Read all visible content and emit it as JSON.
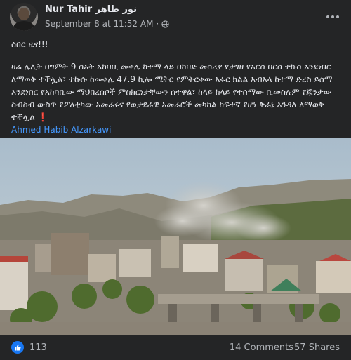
{
  "post": {
    "author": "Nur Tahir نور طاهر",
    "timestamp": "September 8 at 11:52 AM",
    "dot": "·",
    "privacy_icon": "globe-icon",
    "more_icon": "more-options-icon",
    "headline": "ሰበር ዜና!!!",
    "body": "ዛሬ ሌሊት በግምት 9 ሰአት አከባቢ መቀሌ ከተማ ላይ በከባድ መሳሪያ የታገዘ የአርስ በርስ ተኩስ እንደነበር ለማወቅ ተችሏል፣ ተኩሱ ከመቀሌ 47.9 ኪሎ ሜትር የምትርቀው አፋር ክልል አብአላ ከተማ ድረስ ይሰማ እንደነበር የአከባቢው ማህበረሰቦች ምስክርነታቸውን ሰተዋል፣ ከላይ ከላይ የተሰማው ቢመስሉም የጁንታው ስብስብ ውስጥ የፖለቲካው አመራሩና የወታደራዊ አመራሮች መካከል ከፍተኛ የሆነ ቅራኔ እንዳለ ለማወቅ ተችሏል",
    "body_emoji": "❗",
    "tag": "Ahmed Habib Alzarkawi"
  },
  "reactions": {
    "like_icon": "thumbs-up-icon",
    "like_count": "113",
    "comments": "14 Comments",
    "shares": "57 Shares"
  },
  "colors": {
    "background": "#242526",
    "text": "#e4e6eb",
    "secondary_text": "#b0b3b8",
    "link": "#4599ff",
    "like_blue": "#1877f2"
  }
}
